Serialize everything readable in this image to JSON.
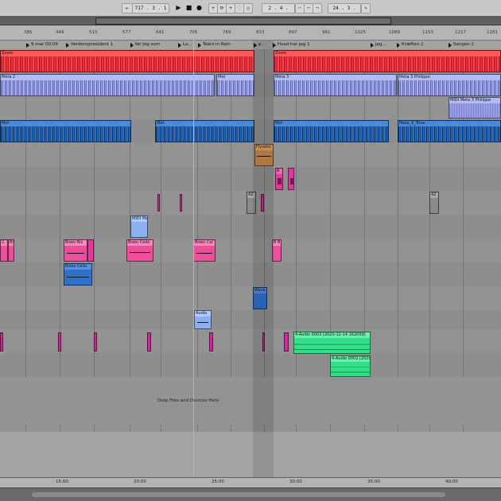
{
  "transport": {
    "loop_start": "717 .  3 .  1",
    "loop_length": "2 .  4 .",
    "end_pos": "24 .  3 ."
  },
  "ruler": {
    "ticks": [
      {
        "label": "385"
      },
      {
        "label": "449"
      },
      {
        "label": "513"
      },
      {
        "label": "577"
      },
      {
        "label": "641"
      },
      {
        "label": "705"
      },
      {
        "label": "769"
      },
      {
        "label": "833"
      },
      {
        "label": "897"
      },
      {
        "label": "961"
      },
      {
        "label": "1025"
      },
      {
        "label": "1089"
      },
      {
        "label": "1153"
      },
      {
        "label": "1217"
      },
      {
        "label": "1281"
      }
    ]
  },
  "locators": [
    {
      "label": "9 mar 00:09"
    },
    {
      "label": "Verdenspresident 1"
    },
    {
      "label": "før jeg som"
    },
    {
      "label": "La..."
    },
    {
      "label": "Tears in Rain"
    },
    {
      "label": "p."
    },
    {
      "label": "Hvad har jeg 1"
    },
    {
      "label": "jeg..."
    },
    {
      "label": "Kræften 2"
    },
    {
      "label": "Sangen 2"
    }
  ],
  "clips": {
    "zoom": "Zoom",
    "meta": "Meta 2",
    "meta3": "Meta 3",
    "met": "Met",
    "midi_meta3_philippe": "MIDI Meta 3 Philippe",
    "meta3_philippe": "Meta 3 Philippe",
    "meta3_trine": "Meta_3_Trine",
    "flyveto": "Flyveto",
    "midi_me": "MIDI Me",
    "bisko_cello": "Bisko Cello",
    "bisko_cel": "Bisko Cel",
    "bisko_bis": "Bisko Bis",
    "bisko_bi": "Bi",
    "bb": "B B",
    "audio": "Audio",
    "wave_clip": "Wave",
    "audio_0003": "4-Audio 0003 [2020-12-14 162059]",
    "audio_0002": "4-Audio 0002 [2020",
    "n42a": "42",
    "n42b": "42",
    "r_clip": "R",
    "s1": "2. F1",
    "s2": "All"
  },
  "dropzone": {
    "text": "Drop Files and Devices Here"
  },
  "time_ruler": {
    "ticks": [
      {
        "label": "15:00"
      },
      {
        "label": "20:00"
      },
      {
        "label": "25:00"
      },
      {
        "label": "30:00"
      },
      {
        "label": "35:00"
      },
      {
        "label": "40:00"
      }
    ]
  },
  "colors": {
    "red": "#e8323a",
    "lavender": "#9aa2ea",
    "blue": "#2e6fc0",
    "orange": "#c98a4c",
    "pink": "#e03a9e",
    "green": "#33e08a",
    "playhead": "#5fd8e8"
  }
}
